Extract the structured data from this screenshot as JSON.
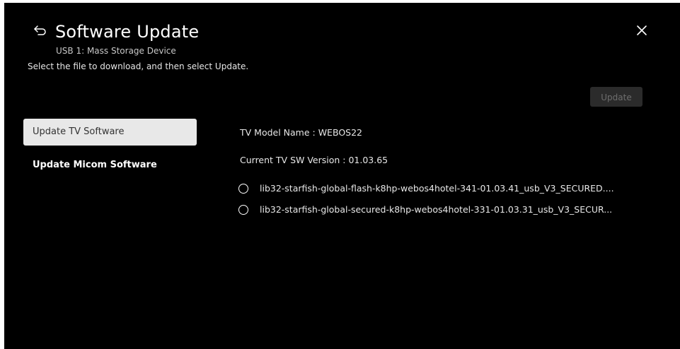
{
  "header": {
    "title": "Software Update",
    "subtitle": "USB 1: Mass Storage Device",
    "instruction": "Select the file to download, and then select Update.",
    "back_icon": "back-arrow-icon",
    "close_icon": "close-icon"
  },
  "toolbar": {
    "update_label": "Update",
    "update_enabled": false
  },
  "sidebar": {
    "items": [
      {
        "label": "Update TV Software",
        "selected": true
      },
      {
        "label": "Update Micom Software",
        "selected": false
      }
    ]
  },
  "main": {
    "model_line": "TV Model Name : WEBOS22",
    "version_line": "Current TV SW Version : 01.03.65",
    "files": [
      {
        "label": "lib32-starfish-global-flash-k8hp-webos4hotel-341-01.03.41_usb_V3_SECURED....",
        "checked": false
      },
      {
        "label": "lib32-starfish-global-secured-k8hp-webos4hotel-331-01.03.31_usb_V3_SECUR...",
        "checked": false
      }
    ]
  },
  "colors": {
    "background": "#000000",
    "selected_item_bg": "#e8e8e8",
    "disabled_button_bg": "#2b2b2b"
  }
}
